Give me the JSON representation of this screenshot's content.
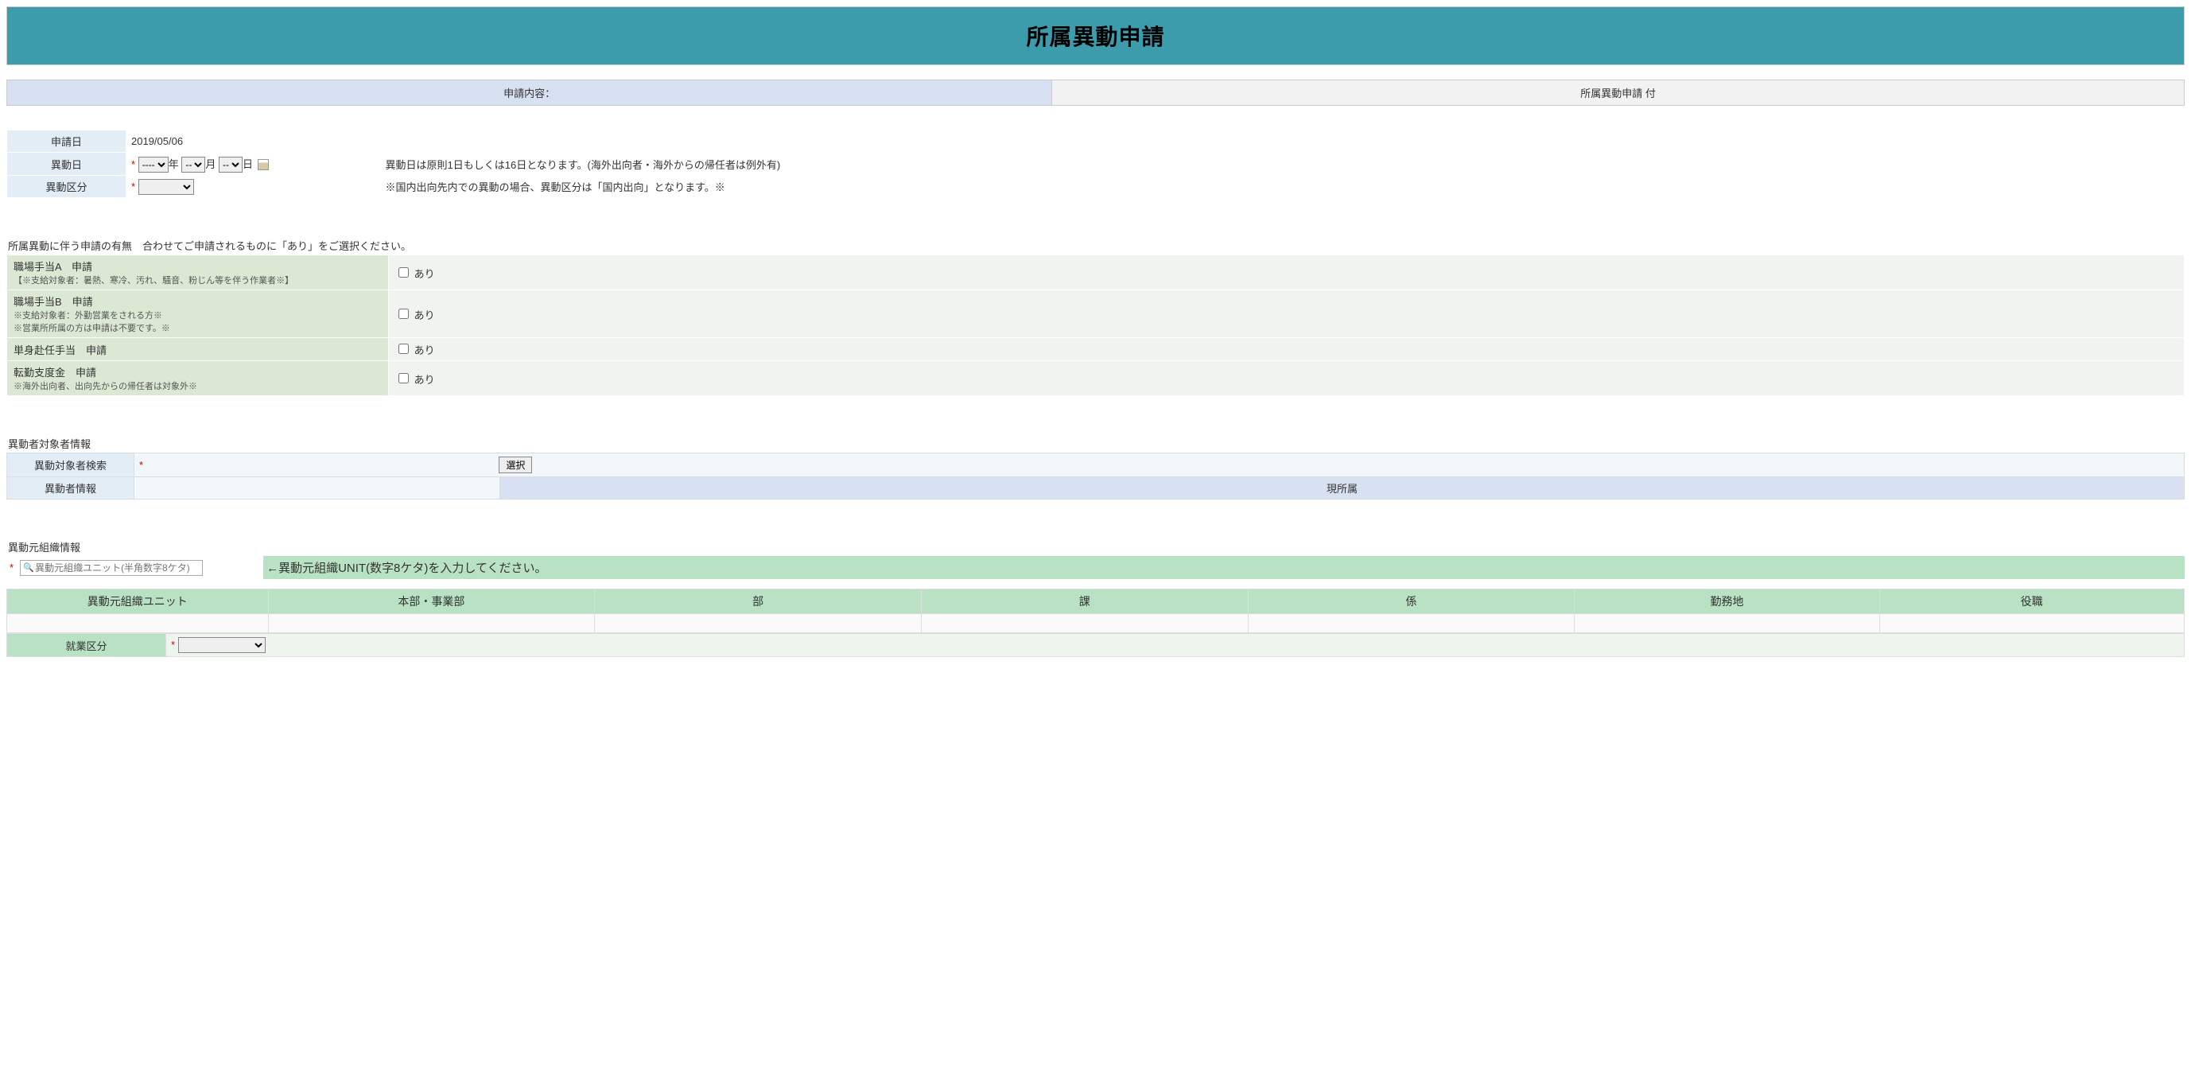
{
  "title": "所属異動申請",
  "content_header": {
    "left": "申請内容：",
    "right": "所属異動申請 付"
  },
  "rows": {
    "application_date_label": "申請日",
    "application_date_value": "2019/05/06",
    "transfer_date_label": "異動日",
    "year_placeholder": "----",
    "year_suffix": "年",
    "month_placeholder": "--",
    "month_suffix": "月",
    "day_placeholder": "--",
    "day_suffix": "日",
    "transfer_date_note": "異動日は原則1日もしくは16日となります。(海外出向者・海外からの帰任者は例外有)",
    "transfer_category_label": "異動区分",
    "transfer_category_note": "※国内出向先内での異動の場合、異動区分は「国内出向」となります。※"
  },
  "green_section_header": "所属異動に伴う申請の有無　合わせてご申請されるものに「あり」をご選択ください。",
  "green_rows": {
    "a_label": "職場手当A　申請",
    "a_sub": "【※支給対象者：暑熱、寒冷、汚れ、騒音、粉じん等を伴う作業者※】",
    "b_label": "職場手当B　申請",
    "b_sub1": "※支給対象者：外勤営業をされる方※",
    "b_sub2": "※営業所所属の方は申請は不要です。※",
    "c_label": "単身赴任手当　申請",
    "d_label": "転勤支度金　申請",
    "d_sub": "※海外出向者、出向先からの帰任者は対象外※",
    "checkbox_label": "あり"
  },
  "transferee_section": {
    "header": "異動者対象者情報",
    "search_label": "異動対象者検索",
    "select_btn": "選択",
    "info_label": "異動者情報",
    "current_affiliation": "現所属"
  },
  "org_source_section": {
    "header": "異動元組織情報",
    "search_placeholder": "異動元組織ユニット(半角数字8ケタ)",
    "instruction": "←異動元組織UNIT(数字8ケタ)を入力してください。",
    "columns": [
      "異動元組織ユニット",
      "本部・事業部",
      "部",
      "課",
      "係",
      "勤務地",
      "役職"
    ],
    "work_class_label": "就業区分"
  }
}
